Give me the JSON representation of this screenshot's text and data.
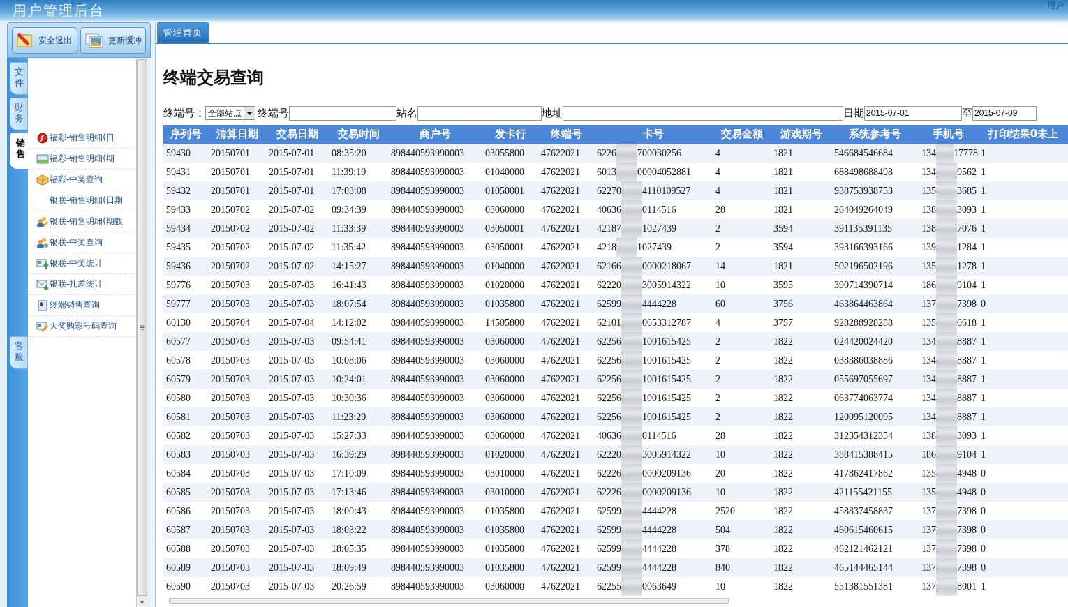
{
  "header": {
    "title": "用户管理后台",
    "user_label": "用户"
  },
  "sidebar": {
    "buttons": [
      {
        "label": "安全退出",
        "kind": "exit"
      },
      {
        "label": "更新缓冲",
        "kind": "refresh"
      }
    ],
    "tabs": [
      {
        "label": "文件",
        "selected": false
      },
      {
        "label": "财务",
        "selected": false
      },
      {
        "label": "销售",
        "selected": true
      },
      {
        "label": "客服",
        "selected": false
      }
    ],
    "menu": [
      {
        "label": "福彩-销售明细(日",
        "kind": "flash"
      },
      {
        "label": "福彩-销售明细(期",
        "kind": "image"
      },
      {
        "label": "福彩-中奖查询",
        "kind": "box"
      },
      {
        "label": "银联-销售明细(日期",
        "kind": "none"
      },
      {
        "label": "银联-销售明细(期数",
        "kind": "users-pencil"
      },
      {
        "label": "银联-中奖查询",
        "kind": "users-gear"
      },
      {
        "label": "银联-中奖统计",
        "kind": "card-up"
      },
      {
        "label": "银联-扎差统计",
        "kind": "mail-down"
      },
      {
        "label": "终端销售查询",
        "kind": "document"
      },
      {
        "label": "大奖购彩号码查询",
        "kind": "card-pencil"
      }
    ]
  },
  "main": {
    "tabs": [
      {
        "label": "管理首页",
        "selected": true
      }
    ],
    "title": "终端交易查询",
    "filters": {
      "terminal_label": "终端号：",
      "station_select": "全部站点",
      "terminal_no_label": "终端号",
      "station_name_label": "站名",
      "address_label": "地址",
      "date_label": "日期",
      "date_from": "2015-07-01",
      "to_label": "至",
      "date_to": "2015-07-09"
    },
    "table": {
      "columns": [
        "序列号",
        "清算日期",
        "交易日期",
        "交易时间",
        "商户号",
        "发卡行",
        "终端号",
        "卡号",
        "交易金额",
        "游戏期号",
        "系统参考号",
        "手机号",
        "打印结果0未上"
      ],
      "rows": [
        [
          "59430",
          "20150701",
          "2015-07-01",
          "08:35:20",
          "898440593990003",
          "03055800",
          "47622021",
          [
            "6226",
            "700030256"
          ],
          "4",
          "1821",
          "546684546684",
          [
            "134",
            "17778"
          ],
          "1"
        ],
        [
          "59431",
          "20150701",
          "2015-07-01",
          "11:39:19",
          "898440593990003",
          "01040000",
          "47622021",
          [
            "6013",
            "00004052881"
          ],
          "4",
          "1821",
          "688498688498",
          [
            "134",
            "9562"
          ],
          "1"
        ],
        [
          "59432",
          "20150701",
          "2015-07-01",
          "17:03:08",
          "898440593990003",
          "01050001",
          "47622021",
          [
            "62270",
            "4110109527"
          ],
          "4",
          "1821",
          "938753938753",
          [
            "135",
            "3685"
          ],
          "1"
        ],
        [
          "59433",
          "20150702",
          "2015-07-02",
          "09:34:39",
          "898440593990003",
          "03060000",
          "47622021",
          [
            "40636",
            "0114516"
          ],
          "28",
          "1821",
          "264049264049",
          [
            "138",
            "3093"
          ],
          "1"
        ],
        [
          "59434",
          "20150702",
          "2015-07-02",
          "11:33:39",
          "898440593990003",
          "03050001",
          "47622021",
          [
            "42187",
            "1027439"
          ],
          "2",
          "3594",
          "391135391135",
          [
            "138",
            "7076"
          ],
          "1"
        ],
        [
          "59435",
          "20150702",
          "2015-07-02",
          "11:35:42",
          "898440593990003",
          "03050001",
          "47622021",
          [
            "4218",
            "1027439"
          ],
          "2",
          "3594",
          "393166393166",
          [
            "139",
            "1284"
          ],
          "1"
        ],
        [
          "59436",
          "20150702",
          "2015-07-02",
          "14:15:27",
          "898440593990003",
          "01040000",
          "47622021",
          [
            "62166",
            "0000218067"
          ],
          "14",
          "1821",
          "502196502196",
          [
            "135",
            "1278"
          ],
          "1"
        ],
        [
          "59776",
          "20150703",
          "2015-07-03",
          "16:41:43",
          "898440593990003",
          "01020000",
          "47622021",
          [
            "62220",
            "3005914322"
          ],
          "10",
          "3595",
          "390714390714",
          [
            "186",
            "9104"
          ],
          "1"
        ],
        [
          "59777",
          "20150703",
          "2015-07-03",
          "18:07:54",
          "898440593990003",
          "01035800",
          "47622021",
          [
            "62599",
            "4444228"
          ],
          "60",
          "3756",
          "463864463864",
          [
            "137",
            "7398"
          ],
          "0"
        ],
        [
          "60130",
          "20150704",
          "2015-07-04",
          "14:12:02",
          "898440593990003",
          "14505800",
          "47622021",
          [
            "62101",
            "0053312787"
          ],
          "4",
          "3757",
          "928288928288",
          [
            "135",
            "0618"
          ],
          "1"
        ],
        [
          "60577",
          "20150703",
          "2015-07-03",
          "09:54:41",
          "898440593990003",
          "03060000",
          "47622021",
          [
            "62256",
            "1001615425"
          ],
          "2",
          "1822",
          "024420024420",
          [
            "134",
            "8887"
          ],
          "1"
        ],
        [
          "60578",
          "20150703",
          "2015-07-03",
          "10:08:06",
          "898440593990003",
          "03060000",
          "47622021",
          [
            "62256",
            "1001615425"
          ],
          "2",
          "1822",
          "038886038886",
          [
            "134",
            "8887"
          ],
          "1"
        ],
        [
          "60579",
          "20150703",
          "2015-07-03",
          "10:24:01",
          "898440593990003",
          "03060000",
          "47622021",
          [
            "62256",
            "1001615425"
          ],
          "2",
          "1822",
          "055697055697",
          [
            "134",
            "8887"
          ],
          "1"
        ],
        [
          "60580",
          "20150703",
          "2015-07-03",
          "10:30:36",
          "898440593990003",
          "03060000",
          "47622021",
          [
            "62256",
            "1001615425"
          ],
          "2",
          "1822",
          "063774063774",
          [
            "134",
            "8887"
          ],
          "1"
        ],
        [
          "60581",
          "20150703",
          "2015-07-03",
          "11:23:29",
          "898440593990003",
          "03060000",
          "47622021",
          [
            "62256",
            "1001615425"
          ],
          "2",
          "1822",
          "120095120095",
          [
            "134",
            "8887"
          ],
          "1"
        ],
        [
          "60582",
          "20150703",
          "2015-07-03",
          "15:27:33",
          "898440593990003",
          "03060000",
          "47622021",
          [
            "40636",
            "0114516"
          ],
          "28",
          "1822",
          "312354312354",
          [
            "138",
            "3093"
          ],
          "1"
        ],
        [
          "60583",
          "20150703",
          "2015-07-03",
          "16:39:29",
          "898440593990003",
          "01020000",
          "47622021",
          [
            "62220",
            "3005914322"
          ],
          "10",
          "1822",
          "388415388415",
          [
            "186",
            "9104"
          ],
          "1"
        ],
        [
          "60584",
          "20150703",
          "2015-07-03",
          "17:10:09",
          "898440593990003",
          "03010000",
          "47622021",
          [
            "62226",
            "0000209136"
          ],
          "20",
          "1822",
          "417862417862",
          [
            "135",
            "4948"
          ],
          "0"
        ],
        [
          "60585",
          "20150703",
          "2015-07-03",
          "17:13:46",
          "898440593990003",
          "03010000",
          "47622021",
          [
            "62226",
            "0000209136"
          ],
          "10",
          "1822",
          "421155421155",
          [
            "135",
            "4948"
          ],
          "0"
        ],
        [
          "60586",
          "20150703",
          "2015-07-03",
          "18:00:43",
          "898440593990003",
          "01035800",
          "47622021",
          [
            "62599",
            "4444228"
          ],
          "2520",
          "1822",
          "458837458837",
          [
            "137",
            "7398"
          ],
          "0"
        ],
        [
          "60587",
          "20150703",
          "2015-07-03",
          "18:03:22",
          "898440593990003",
          "01035800",
          "47622021",
          [
            "62599",
            "4444228"
          ],
          "504",
          "1822",
          "460615460615",
          [
            "137",
            "7398"
          ],
          "0"
        ],
        [
          "60588",
          "20150703",
          "2015-07-03",
          "18:05:35",
          "898440593990003",
          "01035800",
          "47622021",
          [
            "62599",
            "4444228"
          ],
          "378",
          "1822",
          "462121462121",
          [
            "137",
            "7398"
          ],
          "0"
        ],
        [
          "60589",
          "20150703",
          "2015-07-03",
          "18:09:49",
          "898440593990003",
          "01035800",
          "47622021",
          [
            "62599",
            "4444228"
          ],
          "840",
          "1822",
          "465144465144",
          [
            "137",
            "7398"
          ],
          "0"
        ],
        [
          "60590",
          "20150703",
          "2015-07-03",
          "20:26:59",
          "898440593990003",
          "03060000",
          "47622021",
          [
            "62255",
            "0063649"
          ],
          "10",
          "1822",
          "551381551381",
          [
            "137",
            "8001"
          ],
          "1"
        ]
      ]
    }
  }
}
